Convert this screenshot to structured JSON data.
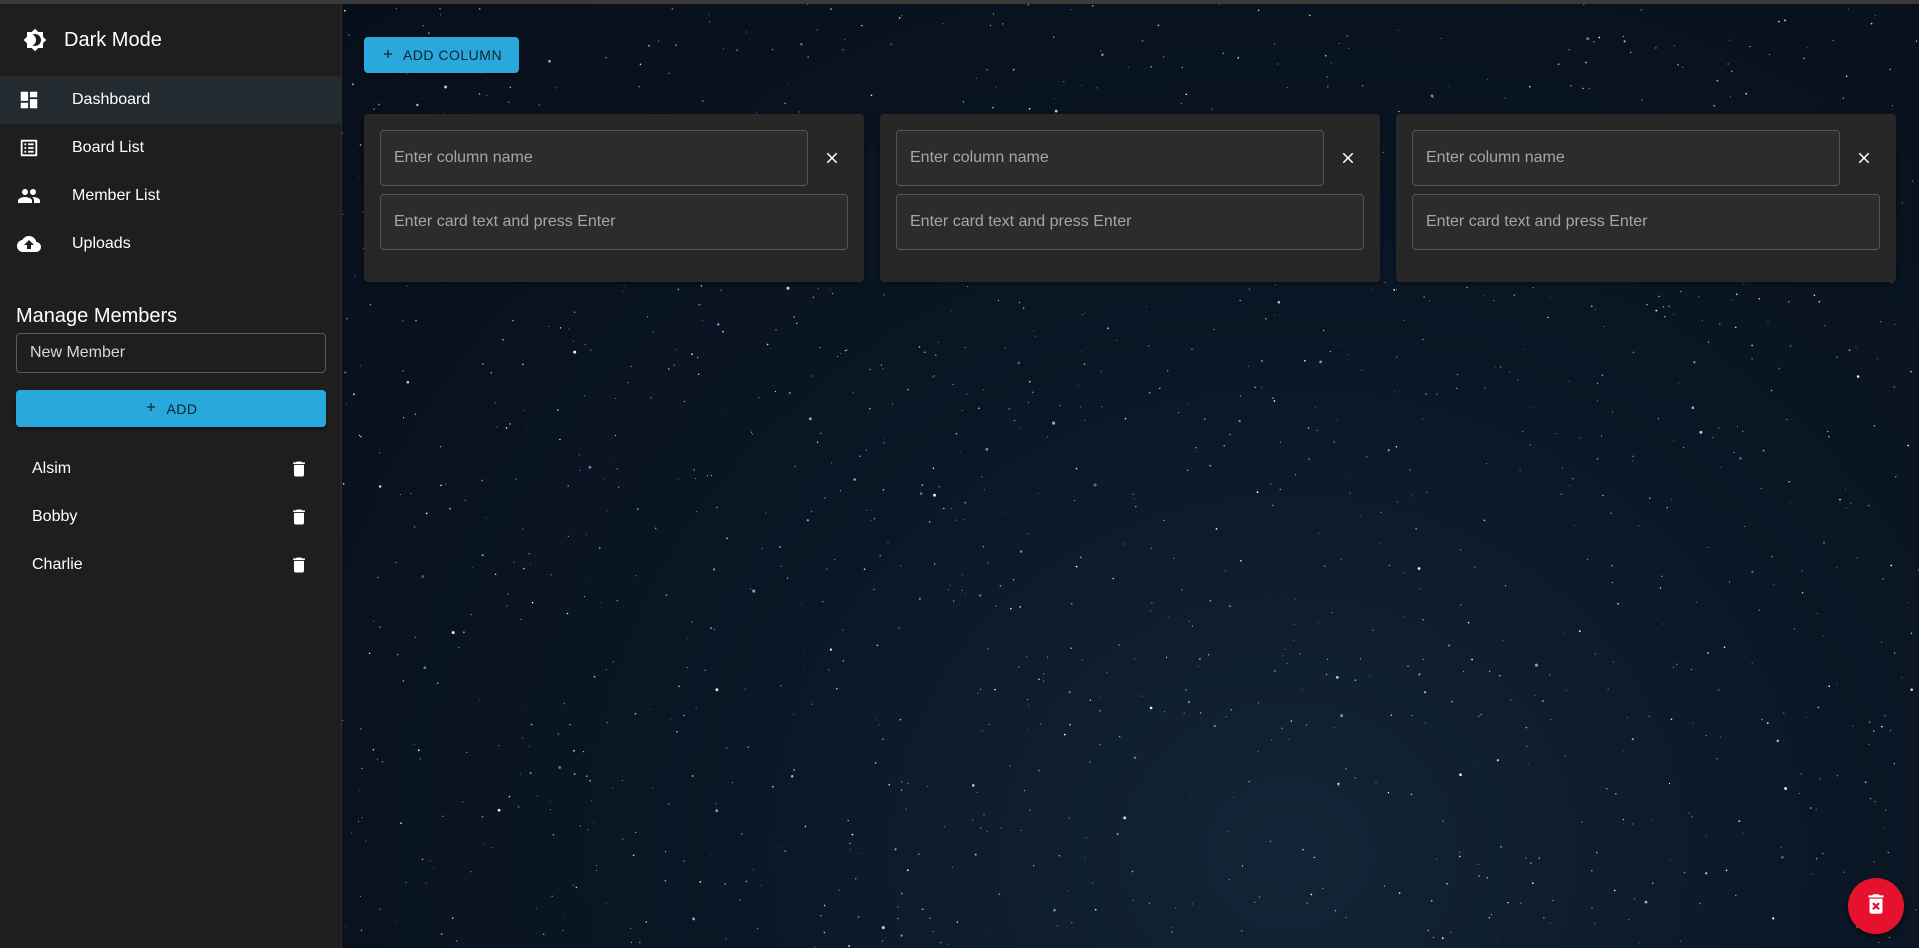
{
  "sidebar": {
    "dark_mode": {
      "label": "Dark Mode",
      "icon": "brightness-icon"
    },
    "nav": [
      {
        "label": "Dashboard",
        "icon": "dashboard-icon",
        "selected": true
      },
      {
        "label": "Board List",
        "icon": "list-alt-icon",
        "selected": false
      },
      {
        "label": "Member List",
        "icon": "people-icon",
        "selected": false
      },
      {
        "label": "Uploads",
        "icon": "cloud-upload-icon",
        "selected": false
      }
    ],
    "manage_members": {
      "title": "Manage Members",
      "input_placeholder": "New Member",
      "add_label": "ADD",
      "members": [
        {
          "name": "Alsim"
        },
        {
          "name": "Bobby"
        },
        {
          "name": "Charlie"
        }
      ]
    }
  },
  "main": {
    "add_column_label": "ADD COLUMN",
    "columns": [
      {
        "name_placeholder": "Enter column name",
        "card_placeholder": "Enter card text and press Enter"
      },
      {
        "name_placeholder": "Enter column name",
        "card_placeholder": "Enter card text and press Enter"
      },
      {
        "name_placeholder": "Enter column name",
        "card_placeholder": "Enter card text and press Enter"
      }
    ],
    "fab_icon": "delete-forever-icon"
  },
  "colors": {
    "accent": "#29a8dd",
    "danger": "#e6112c",
    "sidebar_bg": "#1e1e1e",
    "column_bg": "#272727"
  }
}
